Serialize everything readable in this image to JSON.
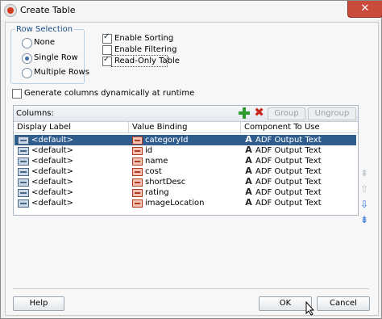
{
  "window": {
    "title": "Create Table",
    "close_glyph": "✕"
  },
  "row_selection": {
    "legend": "Row Selection",
    "options": [
      "None",
      "Single Row",
      "Multiple Rows"
    ],
    "selected": "Single Row"
  },
  "options": {
    "enable_sorting": {
      "label": "Enable Sorting",
      "checked": true
    },
    "enable_filtering": {
      "label": "Enable Filtering",
      "checked": false
    },
    "read_only_table": {
      "label": "Read-Only Table",
      "checked": true
    }
  },
  "generate_columns": {
    "label": "Generate columns dynamically at runtime",
    "checked": false
  },
  "columns": {
    "title": "Columns:",
    "group_label": "Group",
    "ungroup_label": "Ungroup",
    "headers": [
      "Display Label",
      "Value Binding",
      "Component To Use"
    ],
    "rows": [
      {
        "display": "<default>",
        "binding": "categoryId",
        "component": "ADF Output Text",
        "selected": true
      },
      {
        "display": "<default>",
        "binding": "id",
        "component": "ADF Output Text",
        "selected": false
      },
      {
        "display": "<default>",
        "binding": "name",
        "component": "ADF Output Text",
        "selected": false
      },
      {
        "display": "<default>",
        "binding": "cost",
        "component": "ADF Output Text",
        "selected": false
      },
      {
        "display": "<default>",
        "binding": "shortDesc",
        "component": "ADF Output Text",
        "selected": false
      },
      {
        "display": "<default>",
        "binding": "rating",
        "component": "ADF Output Text",
        "selected": false
      },
      {
        "display": "<default>",
        "binding": "imageLocation",
        "component": "ADF Output Text",
        "selected": false
      }
    ]
  },
  "icons": {
    "add": "plus-icon",
    "remove": "x-icon",
    "move_top": "arrow-top-icon",
    "move_up": "arrow-up-icon",
    "move_down": "arrow-down-icon",
    "move_bottom": "arrow-bottom-icon",
    "adf_glyph": "A",
    "arrow_top_glyph": "⇞",
    "arrow_up_glyph": "⇧",
    "arrow_down_glyph": "⇩",
    "arrow_bottom_glyph": "⇟"
  },
  "buttons": {
    "help": "Help",
    "ok": "OK",
    "cancel": "Cancel"
  },
  "colors": {
    "selection": "#2e5d8e",
    "close": "#c94b3c",
    "accent": "#1a4e8a"
  }
}
